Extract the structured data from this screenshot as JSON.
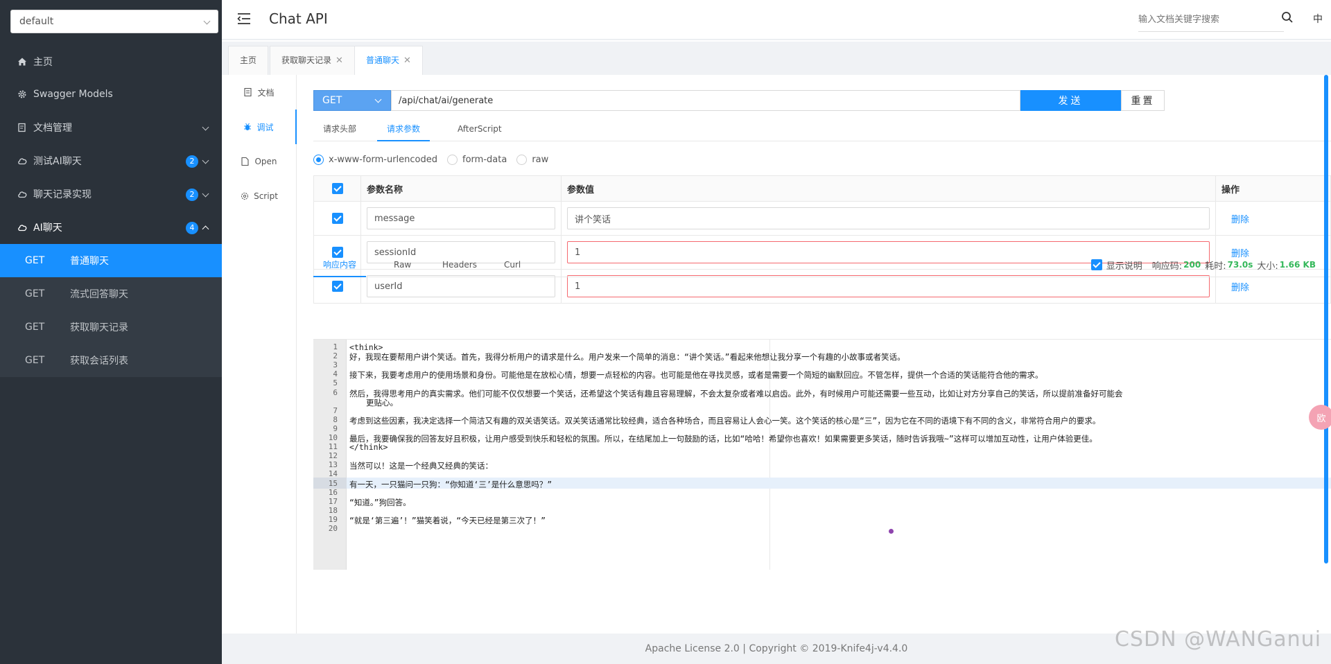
{
  "sidebar": {
    "group_select": "default",
    "menu": [
      {
        "label": "主页"
      },
      {
        "label": "Swagger Models"
      },
      {
        "label": "文档管理"
      },
      {
        "label": "测试AI聊天",
        "badge": "2"
      },
      {
        "label": "聊天记录实现",
        "badge": "2"
      },
      {
        "label": "AI聊天",
        "badge": "4"
      }
    ],
    "sub_items": [
      {
        "method": "GET",
        "label": "普通聊天"
      },
      {
        "method": "GET",
        "label": "流式回答聊天"
      },
      {
        "method": "GET",
        "label": "获取聊天记录"
      },
      {
        "method": "GET",
        "label": "获取会话列表"
      }
    ]
  },
  "header": {
    "title": "Chat API",
    "search_placeholder": "输入文档关键字搜索",
    "lang": "中"
  },
  "tabs": [
    {
      "label": "主页"
    },
    {
      "label": "获取聊天记录"
    },
    {
      "label": "普通聊天"
    }
  ],
  "rail": [
    {
      "label": "文档"
    },
    {
      "label": "调试"
    },
    {
      "label": "Open"
    },
    {
      "label": "Script"
    }
  ],
  "request": {
    "method": "GET",
    "url": "/api/chat/ai/generate",
    "send_label": "发送",
    "reset_label": "重置"
  },
  "param_tabs": [
    "请求头部",
    "请求参数",
    "AfterScript"
  ],
  "content_types": [
    "x-www-form-urlencoded",
    "form-data",
    "raw"
  ],
  "params_table": {
    "headers": [
      "参数名称",
      "参数值",
      "操作"
    ],
    "rows": [
      {
        "name": "message",
        "value": "讲个笑话",
        "action": "删除"
      },
      {
        "name": "sessionId",
        "value": "1",
        "action": "删除"
      },
      {
        "name": "userId",
        "value": "1",
        "action": "删除"
      }
    ]
  },
  "response_tabs": [
    "响应内容",
    "Raw",
    "Headers",
    "Curl"
  ],
  "response_meta": {
    "show_desc": "显示说明",
    "code_label": "响应码:",
    "code": "200",
    "time_label": "耗时:",
    "time": "73.0s",
    "size_label": "大小:",
    "size": "1.66 KB"
  },
  "code_lines": [
    "<think>",
    "好，我现在要帮用户讲个笑话。首先，我得分析用户的请求是什么。用户发来一个简单的消息：“讲个笑话。”看起来他想让我分享一个有趣的小故事或者笑话。",
    "",
    "接下来，我要考虑用户的使用场景和身份。可能他是在放松心情，想要一点轻松的内容。也可能是他在寻找灵感，或者是需要一个简短的幽默回应。不管怎样，提供一个合适的笑话能符合他的需求。",
    "",
    "然后，我得思考用户的真实需求。他们可能不仅仅想要一个笑话，还希望这个笑话有趣且容易理解，不会太复杂或者难以启齿。此外，有时候用户可能还需要一些互动，比如让对方分享自己的笑话，所以提前准备好可能会",
    "更贴心。",
    "",
    "考虑到这些因素，我决定选择一个简洁又有趣的双关语笑话。双关笑话通常比较经典，适合各种场合，而且容易让人会心一笑。这个笑话的核心是“三”，因为它在不同的语境下有不同的含义，非常符合用户的要求。",
    "",
    "最后，我要确保我的回答友好且积极，让用户感受到快乐和轻松的氛围。所以，在结尾加上一句鼓励的话，比如“哈哈！希望你也喜欢！如果需要更多笑话，随时告诉我哦~”这样可以增加互动性，让用户体验更佳。",
    "</think>",
    "",
    "当然可以！这是一个经典又经典的笑话：",
    "",
    "有一天，一只猫问一只狗：“你知道‘三’是什么意思吗？”",
    "",
    "“知道。”狗回答。",
    "",
    "“就是‘第三遍’！”猫笑着说，“今天已经是第三次了！”",
    ""
  ],
  "line_numbers": [
    "1",
    "2",
    "3",
    "4",
    "5",
    "6",
    "",
    "7",
    "8",
    "9",
    "10",
    "11",
    "12",
    "13",
    "14",
    "15",
    "16",
    "17",
    "18",
    "19",
    "20"
  ],
  "float_ball": "欧",
  "footer": "Apache License 2.0 | Copyright © 2019-Knife4j-v4.4.0",
  "watermark": "CSDN @WANGanui"
}
